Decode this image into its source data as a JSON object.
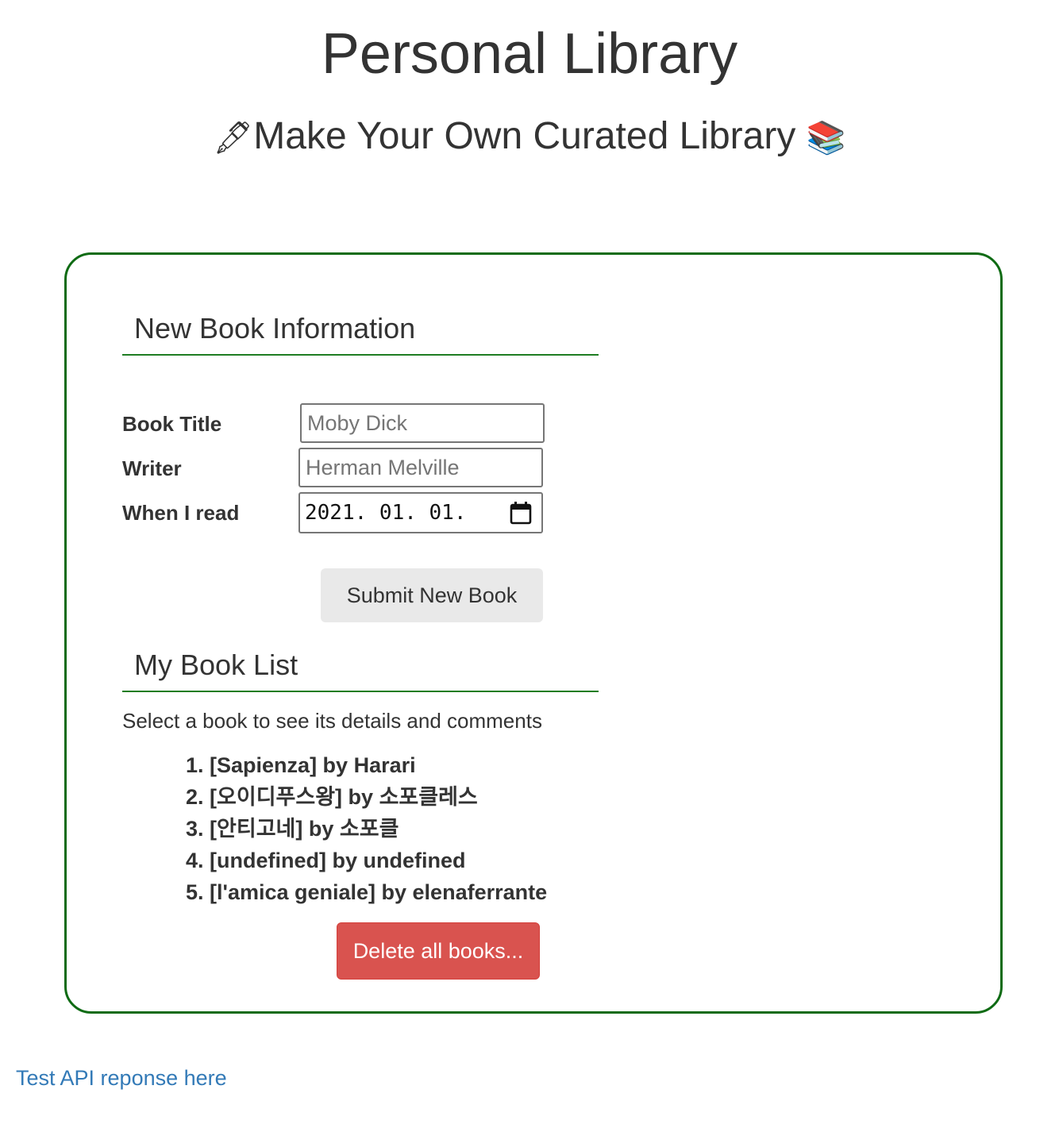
{
  "header": {
    "title": "Personal Library",
    "subtitle_icon_left": "🖋",
    "subtitle_text": "Make Your Own Curated Library",
    "subtitle_icon_right": "📚"
  },
  "new_book_section": {
    "heading": "New Book Information",
    "fields": {
      "title": {
        "label": "Book Title",
        "placeholder": "Moby Dick",
        "value": ""
      },
      "writer": {
        "label": "Writer",
        "placeholder": "Herman Melville",
        "value": ""
      },
      "date": {
        "label": "When I read",
        "value": "2021. 01. 01."
      }
    },
    "submit_label": "Submit New Book"
  },
  "book_list_section": {
    "heading": "My Book List",
    "hint": "Select a book to see its details and comments",
    "books": [
      "[Sapienza] by Harari",
      "[오이디푸스왕] by 소포클레스",
      "[안티고네] by 소포클",
      "[undefined] by undefined",
      "[l'amica geniale] by elenaferrante"
    ],
    "delete_label": "Delete all books..."
  },
  "footer": {
    "link_text": "Test API reponse here"
  },
  "colors": {
    "card_border": "#0f6b14",
    "delete_button": "#d9534f",
    "link": "#337ab7"
  }
}
